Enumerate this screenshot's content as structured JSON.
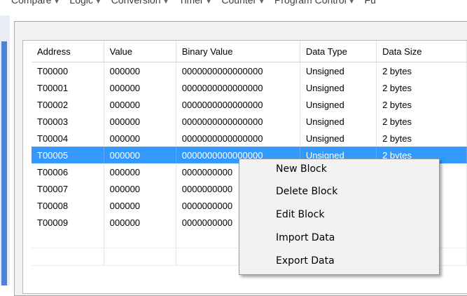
{
  "ribbon": {
    "items": [
      "Compare",
      "Logic",
      "Conversion",
      "Timer",
      "Counter",
      "Program Control",
      "Fu"
    ]
  },
  "table": {
    "columns": [
      "Address",
      "Value",
      "Binary Value",
      "Data Type",
      "Data Size"
    ],
    "rows": [
      [
        "T00000",
        "000000",
        "0000000000000000",
        "Unsigned",
        "2 bytes"
      ],
      [
        "T00001",
        "000000",
        "0000000000000000",
        "Unsigned",
        "2 bytes"
      ],
      [
        "T00002",
        "000000",
        "0000000000000000",
        "Unsigned",
        "2 bytes"
      ],
      [
        "T00003",
        "000000",
        "0000000000000000",
        "Unsigned",
        "2 bytes"
      ],
      [
        "T00004",
        "000000",
        "0000000000000000",
        "Unsigned",
        "2 bytes"
      ],
      [
        "T00005",
        "000000",
        "0000000000000000",
        "Unsigned",
        "2 bytes"
      ],
      [
        "T00006",
        "000000",
        "0000000000",
        "",
        ""
      ],
      [
        "T00007",
        "000000",
        "0000000000",
        "",
        ""
      ],
      [
        "T00008",
        "000000",
        "0000000000",
        "",
        ""
      ],
      [
        "T00009",
        "000000",
        "0000000000",
        "",
        ""
      ]
    ],
    "selected_row": 5
  },
  "context_menu": {
    "items": [
      "New Block",
      "Delete Block",
      "Edit Block",
      "Import Data",
      "Export Data"
    ]
  },
  "colors": {
    "selection": "#3399ff",
    "left_strip": "#4f81d8"
  }
}
